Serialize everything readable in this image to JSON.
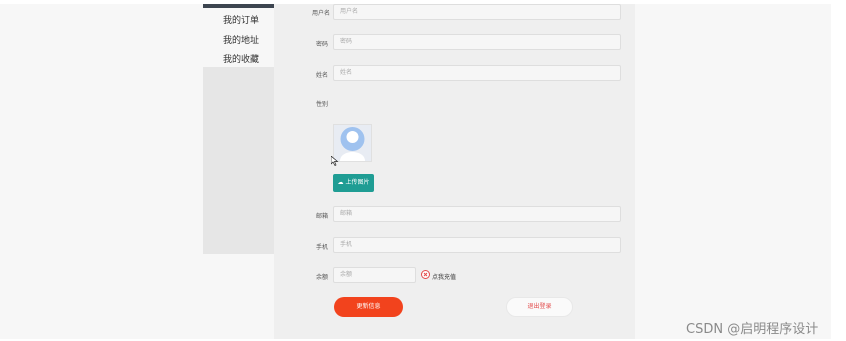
{
  "sidebar": {
    "items": [
      {
        "label": "我的订单"
      },
      {
        "label": "我的地址"
      },
      {
        "label": "我的收藏"
      }
    ]
  },
  "form": {
    "username": {
      "label": "用户名",
      "placeholder": "用户名"
    },
    "password": {
      "label": "密码",
      "placeholder": "密码"
    },
    "name": {
      "label": "姓名",
      "placeholder": "姓名"
    },
    "gender": {
      "label": "性别"
    },
    "upload_label": "上传图片",
    "email": {
      "label": "邮箱",
      "placeholder": "邮箱"
    },
    "phone": {
      "label": "手机",
      "placeholder": "手机"
    },
    "balance": {
      "label": "余额",
      "placeholder": "余额"
    },
    "charge_label": "点我充值"
  },
  "actions": {
    "update_label": "更新信息",
    "logout_label": "退出登录"
  },
  "watermark": "CSDN @启明程序设计",
  "colors": {
    "upload_button": "#1f9d94",
    "update_button": "#f2431d",
    "logout_text": "#e34b4b",
    "sidebar_topbar": "#3d4550"
  }
}
